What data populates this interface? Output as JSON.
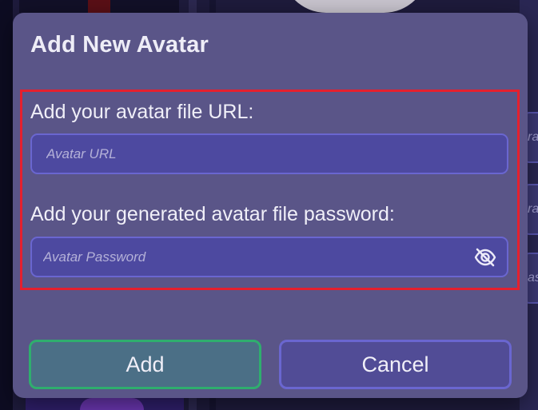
{
  "background": {
    "right_items": [
      "ra",
      "ra",
      "as"
    ]
  },
  "modal": {
    "title": "Add New Avatar",
    "url_label": "Add your avatar file URL:",
    "url_placeholder": "Avatar URL",
    "url_value": "",
    "password_label": "Add your generated avatar file password:",
    "password_placeholder": "Avatar Password",
    "password_value": "",
    "password_toggle_icon": "eye-slash-icon",
    "add_label": "Add",
    "cancel_label": "Cancel"
  },
  "colors": {
    "modal_bg": "#5a5588",
    "field_bg": "#4d49a0",
    "field_border": "#6a66d0",
    "highlight": "#e5202e",
    "add_border": "#2fae6e",
    "add_bg": "#4b6f86",
    "cancel_bg": "#514c96"
  }
}
